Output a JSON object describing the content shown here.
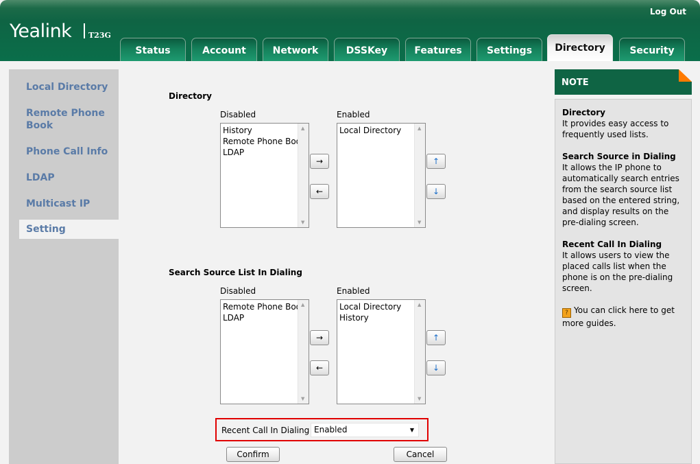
{
  "header": {
    "logo": "Yealink",
    "model": "T23G",
    "logout": "Log Out"
  },
  "tabs": [
    {
      "label": "Status",
      "active": false
    },
    {
      "label": "Account",
      "active": false
    },
    {
      "label": "Network",
      "active": false
    },
    {
      "label": "DSSKey",
      "active": false
    },
    {
      "label": "Features",
      "active": false
    },
    {
      "label": "Settings",
      "active": false
    },
    {
      "label": "Directory",
      "active": true
    },
    {
      "label": "Security",
      "active": false
    }
  ],
  "sidebar": {
    "items": [
      {
        "label": "Local Directory"
      },
      {
        "label": "Remote Phone Book"
      },
      {
        "label": "Phone Call Info"
      },
      {
        "label": "LDAP"
      },
      {
        "label": "Multicast IP"
      },
      {
        "label": "Setting",
        "active": true
      }
    ]
  },
  "directory": {
    "title": "Directory",
    "disabled_label": "Disabled",
    "enabled_label": "Enabled",
    "disabled_items": [
      "History",
      "Remote Phone Book",
      "LDAP"
    ],
    "enabled_items": [
      "Local Directory"
    ]
  },
  "search_source": {
    "title": "Search Source List In Dialing",
    "disabled_label": "Disabled",
    "enabled_label": "Enabled",
    "disabled_items": [
      "Remote Phone Book",
      "LDAP"
    ],
    "enabled_items": [
      "Local Directory",
      "History"
    ]
  },
  "buttons": {
    "move_right": "→",
    "move_left": "←",
    "move_up": "↑",
    "move_down": "↓",
    "confirm": "Confirm",
    "cancel": "Cancel"
  },
  "recent_call": {
    "label": "Recent Call In Dialing",
    "value": "Enabled",
    "caret": "▼"
  },
  "note": {
    "title": "NOTE",
    "blocks": [
      {
        "title": "Directory",
        "text": "It provides easy access to frequently used lists."
      },
      {
        "title": "Search Source in Dialing",
        "text": "It allows the IP phone to automatically search entries from the search source list based on the entered string, and display results on the pre-dialing screen."
      },
      {
        "title": "Recent Call In Dialing",
        "text": "It allows users to view the placed calls list when the phone is on the pre-dialing screen."
      }
    ],
    "help_icon": "?",
    "help_text": "You can click here to get more guides."
  },
  "colors": {
    "brand_green": "#0f6444",
    "sidebar_link": "#5a7ba7",
    "highlight_red": "#e00000",
    "note_corner": "#ff7a00"
  }
}
